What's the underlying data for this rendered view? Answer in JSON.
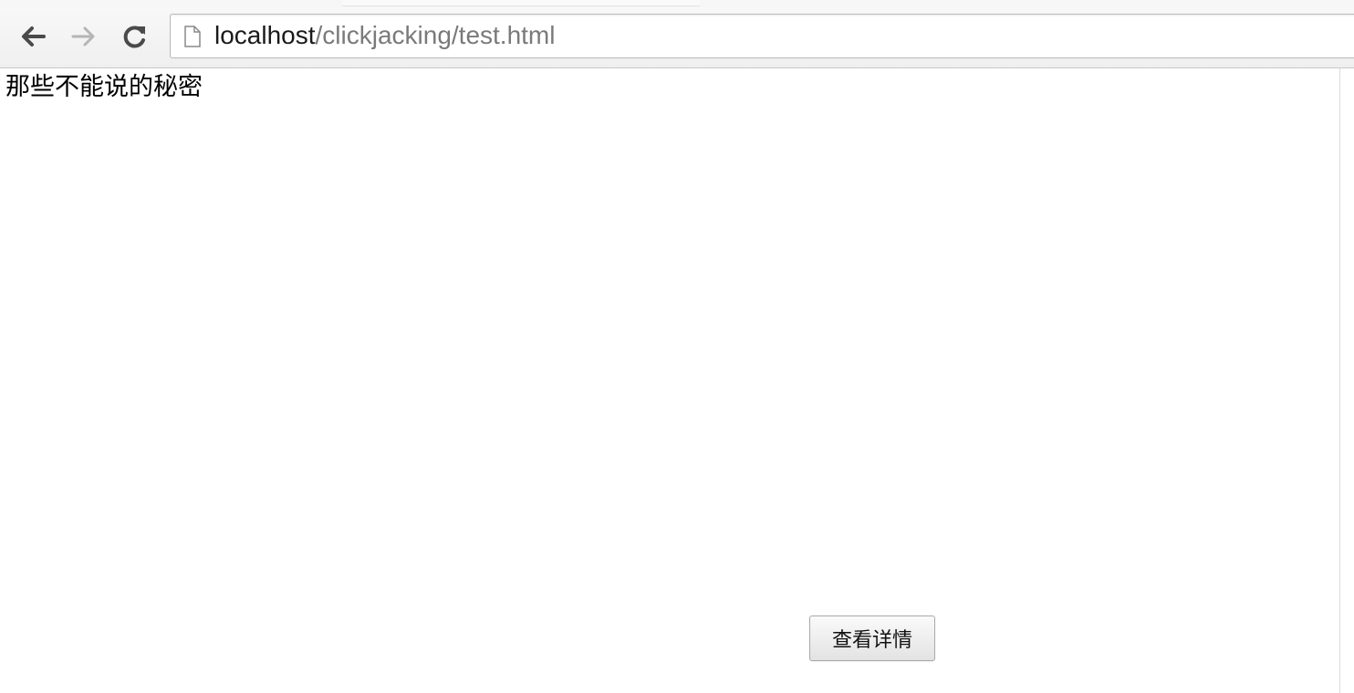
{
  "browser": {
    "toolbar": {
      "back_icon": "arrow-left-icon",
      "forward_icon": "arrow-right-icon",
      "reload_icon": "reload-icon",
      "page_icon": "page-icon"
    },
    "address_bar": {
      "host": "localhost",
      "path": "/clickjacking/test.html"
    }
  },
  "page": {
    "heading": "那些不能说的秘密",
    "details_button_label": "查看详情"
  },
  "colors": {
    "url_host": "#1a1a1a",
    "url_path": "#7a7a7a",
    "back_arrow": "#4a4a4a",
    "forward_arrow": "#b5b5b5"
  }
}
